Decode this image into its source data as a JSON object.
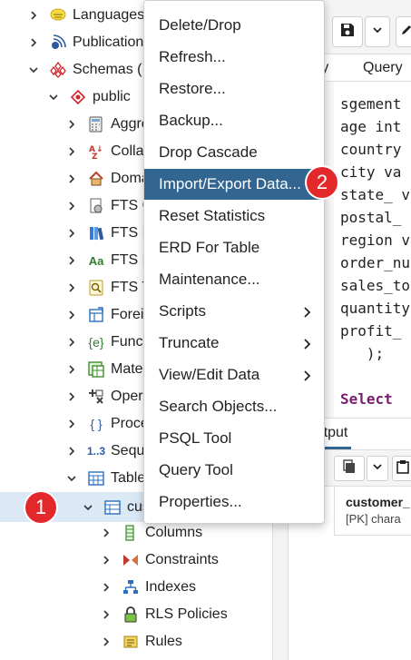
{
  "tree": {
    "rows": [
      {
        "label": "Languages",
        "icon": "languages-icon"
      },
      {
        "label": "Publication",
        "icon": "publication-icon"
      },
      {
        "label": "Schemas (",
        "icon": "schemas-icon"
      },
      {
        "label": "public",
        "icon": "schema-public-icon"
      },
      {
        "label": "Aggre",
        "icon": "aggregates-icon"
      },
      {
        "label": "Collat",
        "icon": "collations-icon"
      },
      {
        "label": "Doma",
        "icon": "domains-icon"
      },
      {
        "label": "FTS C",
        "icon": "fts-configurations-icon"
      },
      {
        "label": "FTS D",
        "icon": "fts-dictionaries-icon"
      },
      {
        "label": "FTS P",
        "icon": "fts-parsers-icon"
      },
      {
        "label": "FTS T",
        "icon": "fts-templates-icon"
      },
      {
        "label": "Foreig",
        "icon": "foreign-tables-icon"
      },
      {
        "label": "Funct",
        "icon": "functions-icon"
      },
      {
        "label": "Mater",
        "icon": "materialized-views-icon"
      },
      {
        "label": "Opera",
        "icon": "operators-icon"
      },
      {
        "label": "Proce",
        "icon": "procedures-icon"
      },
      {
        "label": "Seque",
        "icon": "sequences-icon"
      },
      {
        "label": "Table",
        "icon": "tables-icon"
      },
      {
        "label": "cus",
        "icon": "table-icon"
      },
      {
        "label": "Columns",
        "icon": "columns-icon"
      },
      {
        "label": "Constraints",
        "icon": "constraints-icon"
      },
      {
        "label": "Indexes",
        "icon": "indexes-icon"
      },
      {
        "label": "RLS Policies",
        "icon": "rls-policies-icon"
      },
      {
        "label": "Rules",
        "icon": "rules-icon"
      }
    ]
  },
  "context_menu": {
    "items": [
      {
        "label": "Delete/Drop"
      },
      {
        "label": "Refresh..."
      },
      {
        "label": "Restore..."
      },
      {
        "label": "Backup..."
      },
      {
        "label": "Drop Cascade"
      },
      {
        "label": "Import/Export Data..."
      },
      {
        "label": "Reset Statistics"
      },
      {
        "label": "ERD For Table"
      },
      {
        "label": "Maintenance..."
      },
      {
        "label": "Scripts"
      },
      {
        "label": "Truncate"
      },
      {
        "label": "View/Edit Data"
      },
      {
        "label": "Search Objects..."
      },
      {
        "label": "PSQL Tool"
      },
      {
        "label": "Query Tool"
      },
      {
        "label": "Properties..."
      }
    ]
  },
  "right_pane": {
    "tabs": {
      "tab1": "ery",
      "tab2": "Query"
    },
    "code_lines": [
      "sgement",
      "age int",
      "country",
      "city va",
      "state_ v",
      "postal_",
      "region v",
      "order_nu",
      "sales_to",
      "quantity",
      "profit_",
      "   );",
      "",
      "Select"
    ],
    "output_tab": "a Output",
    "grid_header": {
      "column": "customer_",
      "type": "[PK] chara"
    }
  },
  "badges": {
    "badge1": "1",
    "badge2": "2"
  },
  "colors": {
    "highlight": "#326690",
    "badge": "#e3282c",
    "selected_row": "#dbe9f7"
  }
}
